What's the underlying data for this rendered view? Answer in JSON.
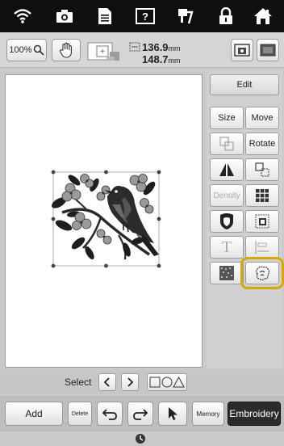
{
  "toolbar": {
    "zoom_label": "100%",
    "size_width_value": "136.9",
    "size_height_value": "148.7",
    "size_unit": "mm"
  },
  "panel": {
    "edit_label": "Edit",
    "size_label": "Size",
    "move_label": "Move",
    "rotate_label": "Rotate",
    "density_label": "Density",
    "text_label": "T"
  },
  "select_row": {
    "select_label": "Select"
  },
  "bottom": {
    "add_label": "Add",
    "delete_label": "Delete",
    "memory_label": "Memory",
    "embroidery_label": "Embroidery"
  },
  "colors": {
    "highlight": "#d4a800",
    "embroidery_button": "#2b2b2b"
  }
}
